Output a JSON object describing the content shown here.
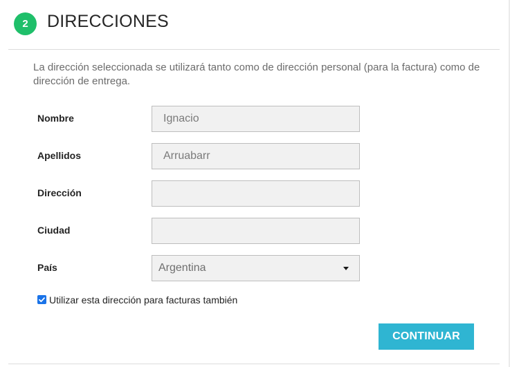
{
  "step": {
    "number": "2",
    "title": "DIRECCIONES"
  },
  "intro_text": "La dirección seleccionada se utilizará tanto como de dirección personal (para la factura) como de dirección de entrega.",
  "form": {
    "first_name": {
      "label": "Nombre",
      "value": "Ignacio"
    },
    "last_name": {
      "label": "Apellidos",
      "value": "Arruabarr"
    },
    "address": {
      "label": "Dirección",
      "value": ""
    },
    "city": {
      "label": "Ciudad",
      "value": ""
    },
    "country": {
      "label": "País",
      "value": "Argentina"
    }
  },
  "billing_checkbox": {
    "label": "Utilizar esta dirección para facturas también",
    "checked": true
  },
  "continue_label": "CONTINUAR",
  "colors": {
    "step_badge": "#1fbf6a",
    "button": "#2fb5d2",
    "checkbox": "#1a73e8"
  }
}
